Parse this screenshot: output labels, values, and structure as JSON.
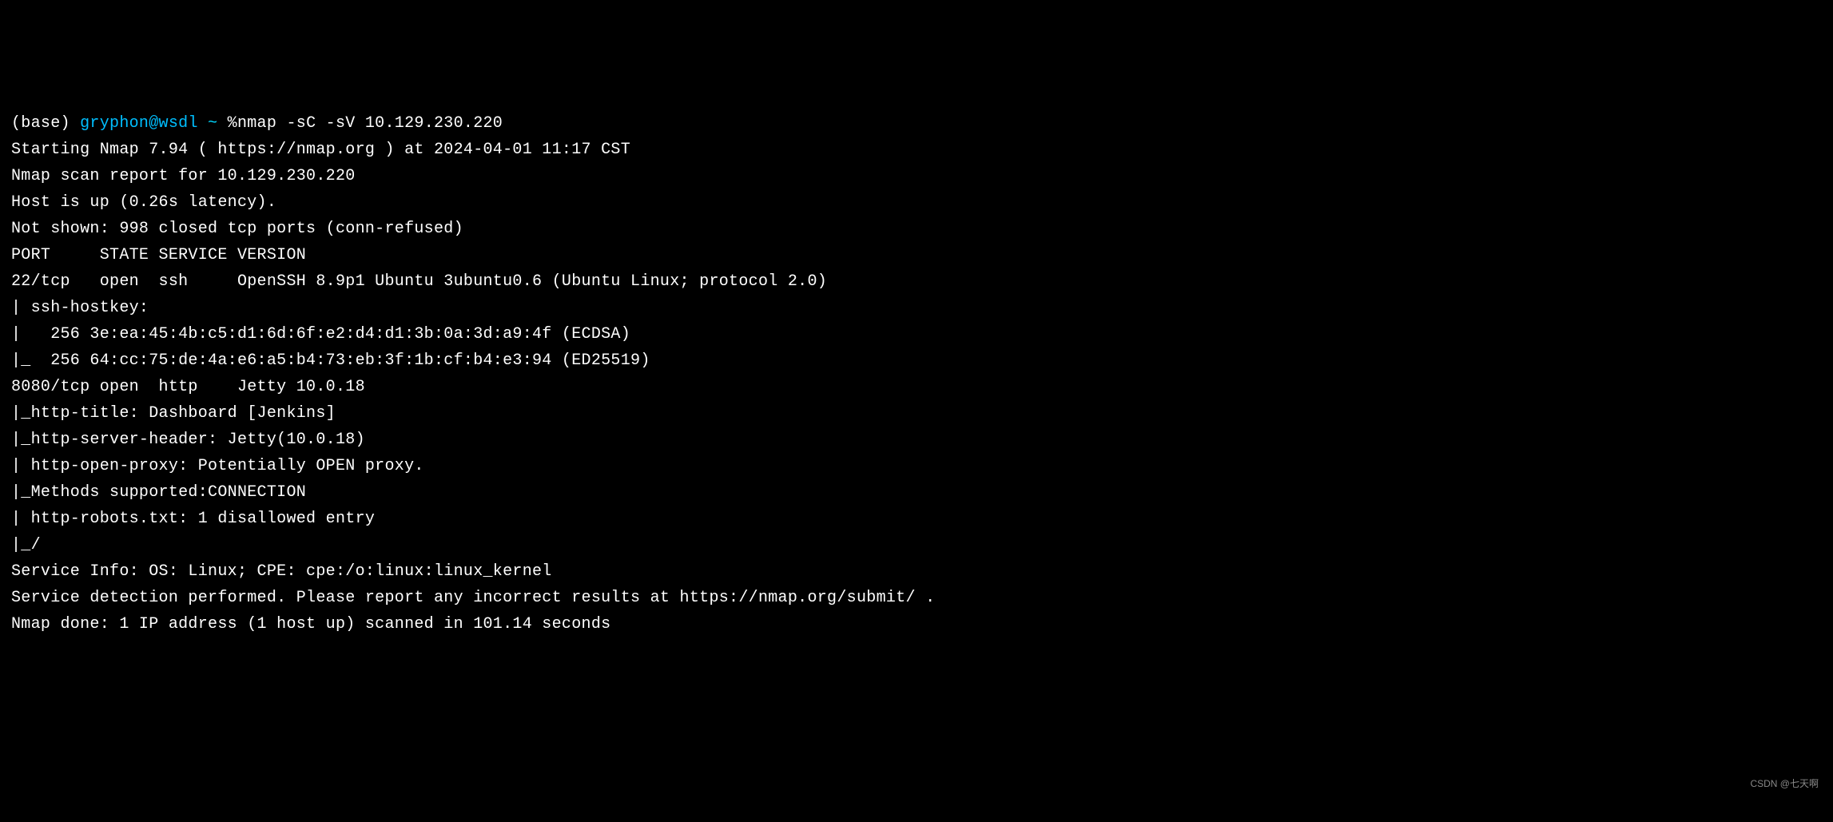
{
  "prompt": {
    "env": "(base) ",
    "user": "gryphon@wsdl",
    "tilde": " ~ ",
    "command": "%nmap -sC -sV 10.129.230.220"
  },
  "lines": [
    "Starting Nmap 7.94 ( https://nmap.org ) at 2024-04-01 11:17 CST",
    "Nmap scan report for 10.129.230.220",
    "Host is up (0.26s latency).",
    "Not shown: 998 closed tcp ports (conn-refused)",
    "PORT     STATE SERVICE VERSION",
    "22/tcp   open  ssh     OpenSSH 8.9p1 Ubuntu 3ubuntu0.6 (Ubuntu Linux; protocol 2.0)",
    "| ssh-hostkey:",
    "|   256 3e:ea:45:4b:c5:d1:6d:6f:e2:d4:d1:3b:0a:3d:a9:4f (ECDSA)",
    "|_  256 64:cc:75:de:4a:e6:a5:b4:73:eb:3f:1b:cf:b4:e3:94 (ED25519)",
    "8080/tcp open  http    Jetty 10.0.18",
    "|_http-title: Dashboard [Jenkins]",
    "|_http-server-header: Jetty(10.0.18)",
    "| http-open-proxy: Potentially OPEN proxy.",
    "|_Methods supported:CONNECTION",
    "| http-robots.txt: 1 disallowed entry",
    "|_/",
    "Service Info: OS: Linux; CPE: cpe:/o:linux:linux_kernel",
    "",
    "Service detection performed. Please report any incorrect results at https://nmap.org/submit/ .",
    "Nmap done: 1 IP address (1 host up) scanned in 101.14 seconds"
  ],
  "watermark": "CSDN @七天啊"
}
